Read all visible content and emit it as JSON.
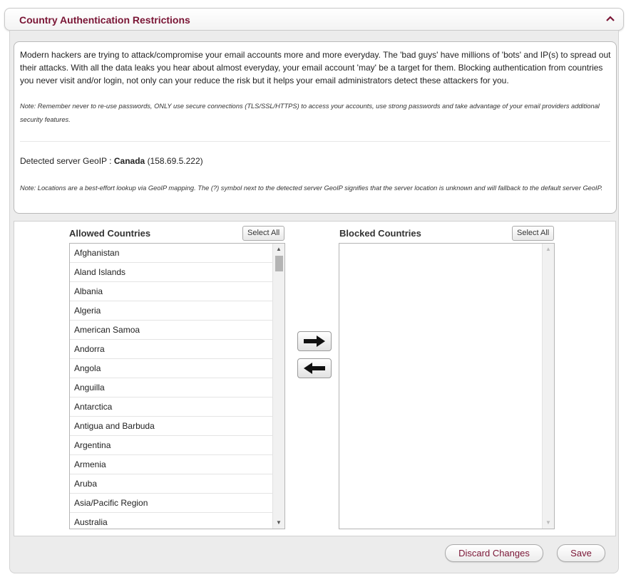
{
  "panel": {
    "title": "Country Authentication Restrictions",
    "collapse_icon": "chevron-up-icon"
  },
  "info": {
    "description": "Modern hackers are trying to attack/compromise your email accounts more and more everyday. The 'bad guys' have millions of 'bots' and IP(s) to spread out their attacks. With all the data leaks you hear about almost everyday, your email account 'may' be a target for them. Blocking authentication from countries you never visit and/or login, not only can your reduce the risk but it helps your email administrators detect these attackers for you.",
    "note_security": "Note: Remember never to re-use passwords, ONLY use secure connections (TLS/SSL/HTTPS) to access your accounts, use strong passwords and take advantage of your email providers additional security features.",
    "geoip_label": "Detected server GeoIP :",
    "geoip_country": "Canada",
    "geoip_ip": "(158.69.5.222)",
    "note_geoip": "Note: Locations are a best-effort lookup via GeoIP mapping. The (?) symbol next to the detected server GeoIP signifies that the server location is unknown and will fallback to the default server GeoIP."
  },
  "allowed": {
    "title": "Allowed Countries",
    "select_all_label": "Select All",
    "items": [
      "Afghanistan",
      "Aland Islands",
      "Albania",
      "Algeria",
      "American Samoa",
      "Andorra",
      "Angola",
      "Anguilla",
      "Antarctica",
      "Antigua and Barbuda",
      "Argentina",
      "Armenia",
      "Aruba",
      "Asia/Pacific Region",
      "Australia"
    ]
  },
  "blocked": {
    "title": "Blocked Countries",
    "select_all_label": "Select All",
    "items": []
  },
  "transfer": {
    "add_icon": "arrow-right-icon",
    "remove_icon": "arrow-left-icon"
  },
  "footer": {
    "discard_label": "Discard Changes",
    "save_label": "Save"
  },
  "colors": {
    "accent": "#7a1535"
  }
}
